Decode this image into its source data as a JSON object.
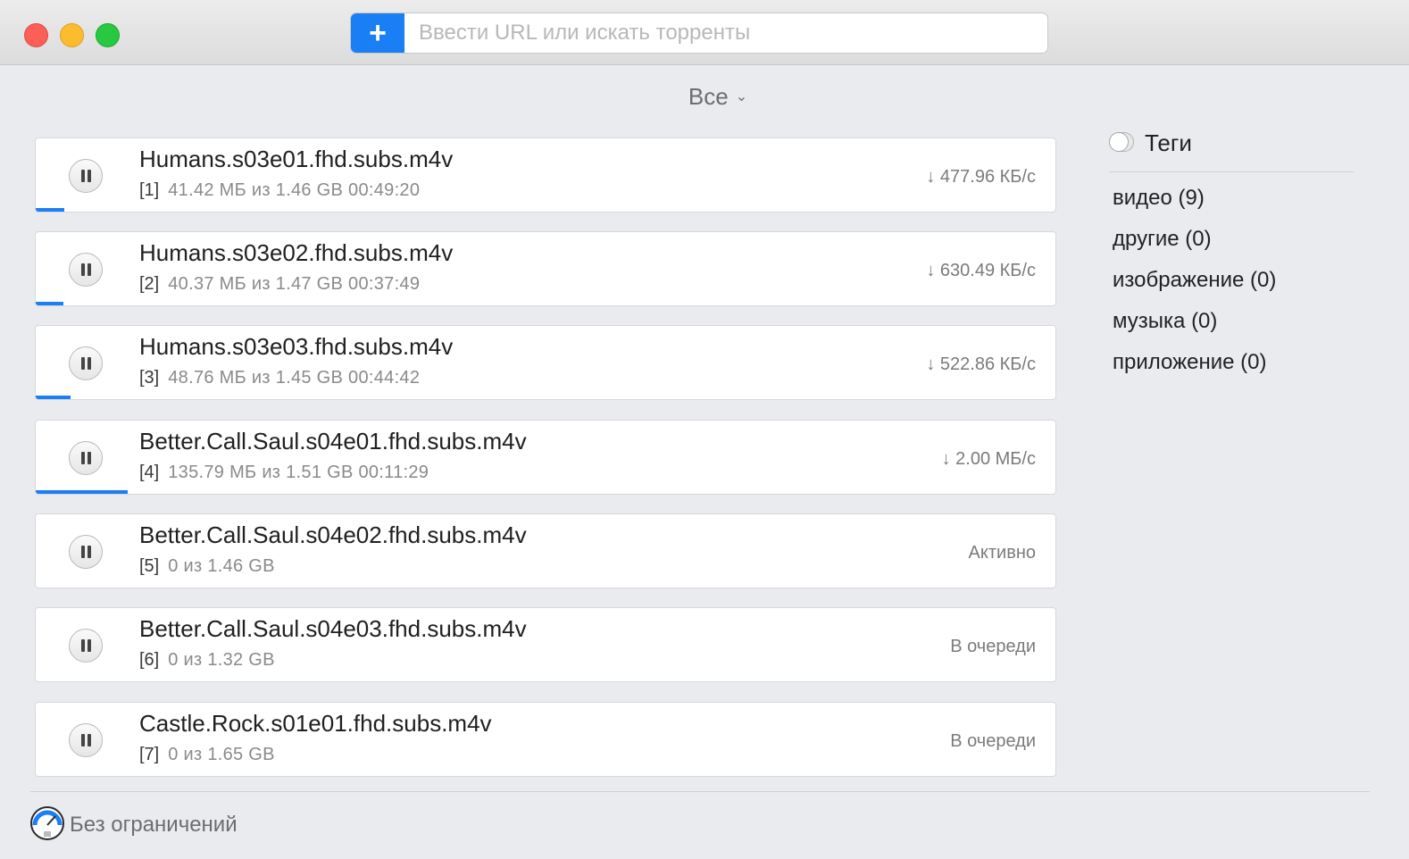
{
  "toolbar": {
    "add_label": "+",
    "url_placeholder": "Ввести URL или искать торренты"
  },
  "filter": {
    "label": "Все",
    "chevron": "⌄"
  },
  "torrents": [
    {
      "name": "Humans.s03e01.fhd.subs.m4v",
      "index": "[1]",
      "details": "41.42 МБ из 1.46 GB 00:49:20",
      "status": "↓ 477.96 КБ/с",
      "progress": 0.028
    },
    {
      "name": "Humans.s03e02.fhd.subs.m4v",
      "index": "[2]",
      "details": "40.37 МБ из 1.47 GB 00:37:49",
      "status": "↓ 630.49 КБ/с",
      "progress": 0.027
    },
    {
      "name": "Humans.s03e03.fhd.subs.m4v",
      "index": "[3]",
      "details": "48.76 МБ из 1.45 GB 00:44:42",
      "status": "↓ 522.86 КБ/с",
      "progress": 0.034
    },
    {
      "name": "Better.Call.Saul.s04e01.fhd.subs.m4v",
      "index": "[4]",
      "details": "135.79 МБ из 1.51 GB 00:11:29",
      "status": "↓ 2.00 МБ/с",
      "progress": 0.09
    },
    {
      "name": "Better.Call.Saul.s04e02.fhd.subs.m4v",
      "index": "[5]",
      "details": "0 из 1.46 GB",
      "status": "Активно",
      "progress": 0
    },
    {
      "name": "Better.Call.Saul.s04e03.fhd.subs.m4v",
      "index": "[6]",
      "details": "0 из 1.32 GB",
      "status": "В очереди",
      "progress": 0
    },
    {
      "name": "Castle.Rock.s01e01.fhd.subs.m4v",
      "index": "[7]",
      "details": "0 из 1.65 GB",
      "status": "В очереди",
      "progress": 0
    }
  ],
  "tags": {
    "title": "Теги",
    "items": [
      "видео (9)",
      "другие (0)",
      "изображение (0)",
      "музыка (0)",
      "приложение (0)"
    ]
  },
  "footer": {
    "speed_limit": "Без ограничений"
  },
  "colors": {
    "accent": "#1a7ef4",
    "close": "#fc5f57",
    "minimize": "#fdbc2e",
    "maximize": "#28c840"
  }
}
